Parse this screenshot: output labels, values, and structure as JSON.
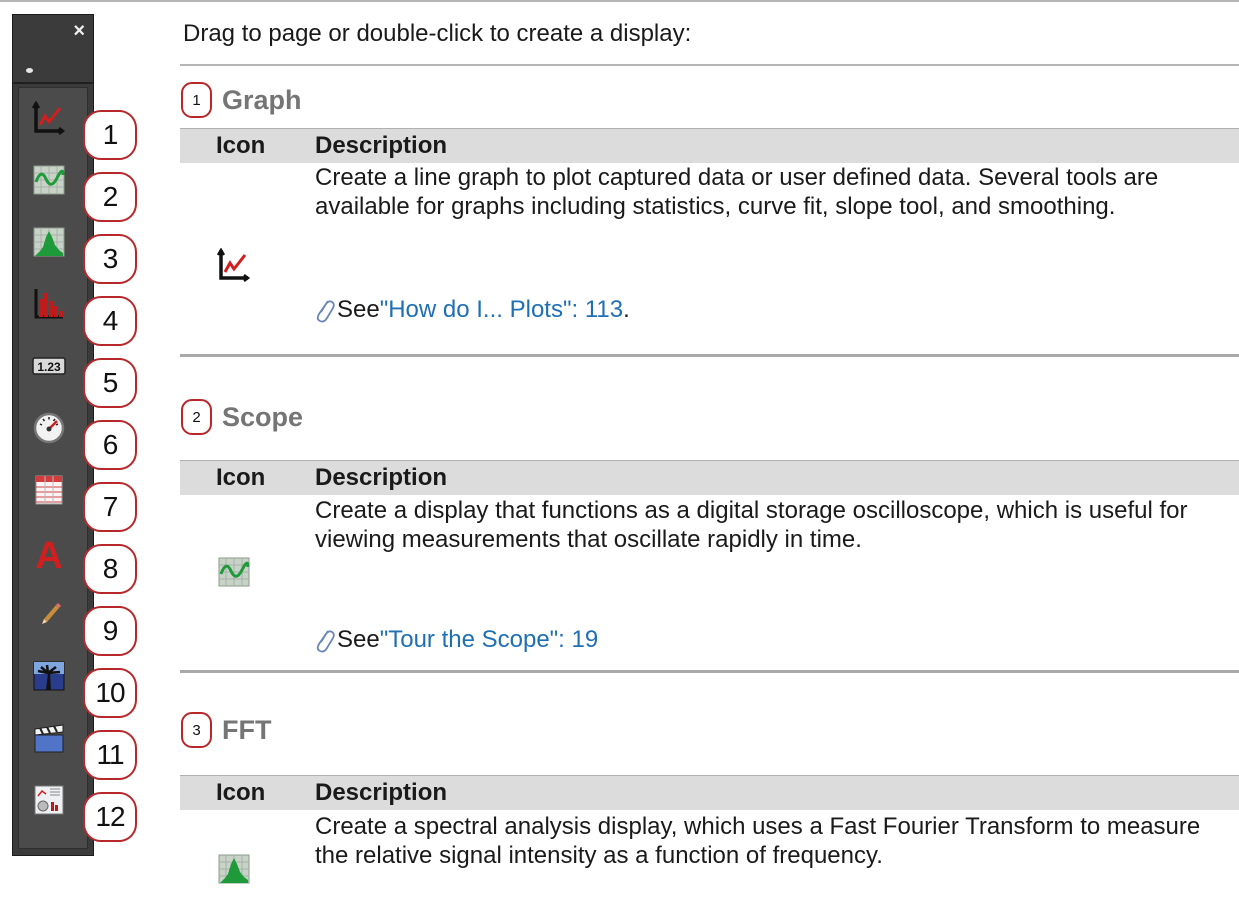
{
  "palette": {
    "close_glyph": "×",
    "items": [
      {
        "num": "1",
        "icon": "line-graph-icon"
      },
      {
        "num": "2",
        "icon": "scope-icon"
      },
      {
        "num": "3",
        "icon": "fft-icon"
      },
      {
        "num": "4",
        "icon": "histogram-icon"
      },
      {
        "num": "5",
        "icon": "digits-icon",
        "icon_text": "1.23"
      },
      {
        "num": "6",
        "icon": "meter-icon"
      },
      {
        "num": "7",
        "icon": "table-icon"
      },
      {
        "num": "8",
        "icon": "text-icon",
        "icon_text": "A"
      },
      {
        "num": "9",
        "icon": "pencil-icon"
      },
      {
        "num": "10",
        "icon": "image-icon"
      },
      {
        "num": "11",
        "icon": "movie-icon"
      },
      {
        "num": "12",
        "icon": "template-icon"
      }
    ]
  },
  "intro": "Drag to page or double-click to create a display:",
  "sections": [
    {
      "num": "1",
      "title": "Graph",
      "col_icon": "Icon",
      "col_desc": "Description",
      "description": "Create a line graph to plot captured data or user defined data. Several tools are available for graphs including statistics, curve fit, slope tool, and smoothing.",
      "see_prefix": "See ",
      "see_link": "\"How do I... Plots\":  113",
      "see_suffix": "."
    },
    {
      "num": "2",
      "title": "Scope",
      "col_icon": "Icon",
      "col_desc": "Description",
      "description": "Create a display that functions as a digital storage oscilloscope, which is useful for viewing measurements that oscillate rapidly in time.",
      "see_prefix": "See ",
      "see_link": "\"Tour the Scope\":  19",
      "see_suffix": ""
    },
    {
      "num": "3",
      "title": "FFT",
      "col_icon": "Icon",
      "col_desc": "Description",
      "description": "Create a spectral analysis display, which uses a Fast Fourier Transform to measure the relative signal intensity as a function of frequency."
    }
  ],
  "colors": {
    "callout_border": "#b8282b",
    "link": "#1f6fb5",
    "palette_bg": "#3b3b3b",
    "header_bg": "#dcdcdc"
  }
}
